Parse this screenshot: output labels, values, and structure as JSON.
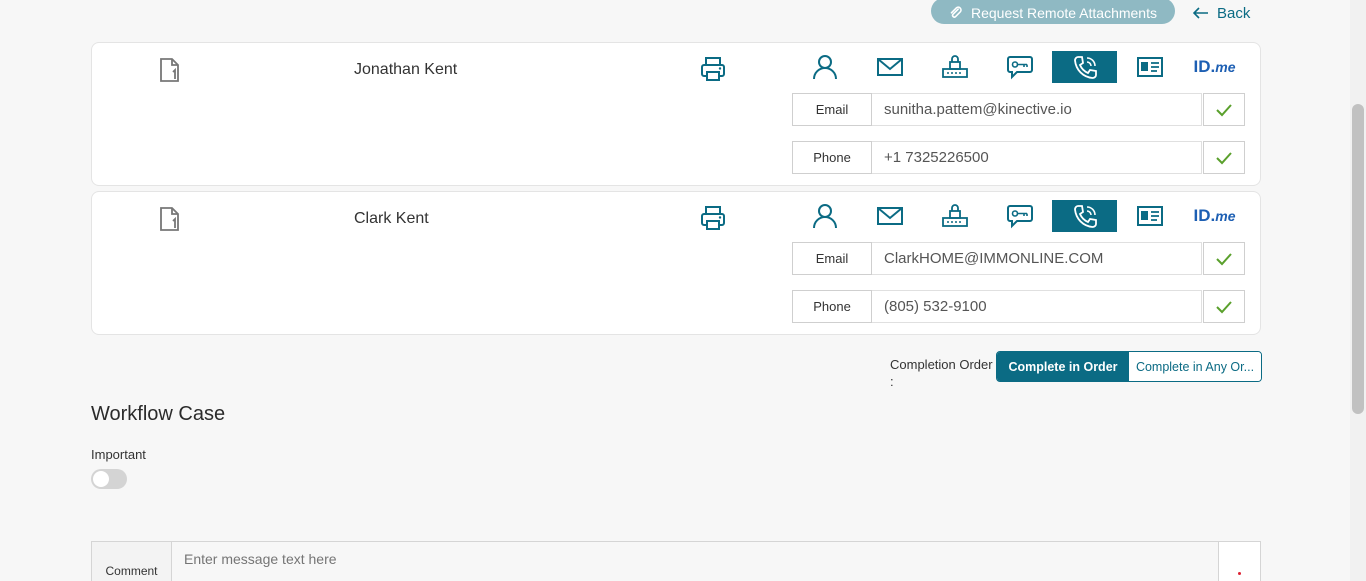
{
  "header": {
    "request_remote_label": "Request Remote Attachments",
    "back_label": "Back"
  },
  "signers": [
    {
      "name": "Jonathan Kent",
      "email_label": "Email",
      "email": "sunitha.pattem@kinective.io",
      "phone_label": "Phone",
      "phone": "+1 7325226500"
    },
    {
      "name": "Clark Kent",
      "email_label": "Email",
      "email": "ClarkHOME@IMMONLINE.COM",
      "phone_label": "Phone",
      "phone": "(805) 532-9100"
    }
  ],
  "auth_methods": [
    "person-icon",
    "envelope-icon",
    "router-icon",
    "otp-chat-icon",
    "phone-icon",
    "id-card-icon",
    "idme-logo"
  ],
  "active_method": "phone-icon",
  "idme_logo": {
    "id": "ID.",
    "me": "me"
  },
  "completion": {
    "label": "Completion Order :",
    "options": [
      "Complete in Order",
      "Complete in Any Or..."
    ],
    "selected": "Complete in Order"
  },
  "workflow": {
    "title": "Workflow Case",
    "important_label": "Important",
    "important_on": false
  },
  "comment": {
    "label": "Comment",
    "placeholder": "Enter message text here"
  },
  "colors": {
    "accent": "#0b6b84",
    "check": "#5aa02c",
    "remote_button": "#8fb9c3",
    "idme": "#1d5fb3"
  }
}
